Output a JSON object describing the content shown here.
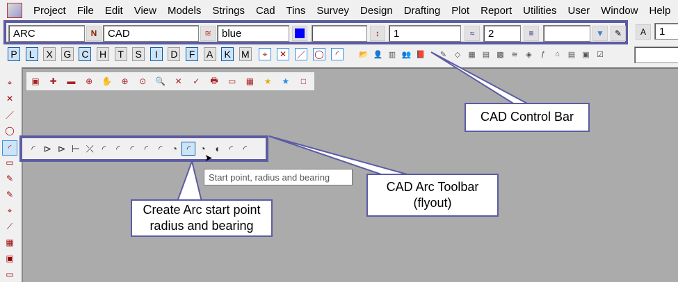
{
  "menu": [
    "Project",
    "File",
    "Edit",
    "View",
    "Models",
    "Strings",
    "Cad",
    "Tins",
    "Survey",
    "Design",
    "Drafting",
    "Plot",
    "Report",
    "Utilities",
    "User",
    "Window",
    "Help"
  ],
  "cad_control_bar": {
    "name_value": "ARC",
    "model_value": "CAD",
    "colour_value": "blue",
    "colour_hex": "#0000ff",
    "height_value": "",
    "chainage_value": "1",
    "weight_value": "2",
    "linestyle_value": "",
    "text_size_value": "1"
  },
  "snap_buttons": [
    {
      "label": "P",
      "on": true
    },
    {
      "label": "L",
      "on": true
    },
    {
      "label": "X",
      "on": false
    },
    {
      "label": "G",
      "on": false
    },
    {
      "label": "C",
      "on": true
    },
    {
      "label": "H",
      "on": false
    },
    {
      "label": "T",
      "on": false
    },
    {
      "label": "S",
      "on": false
    },
    {
      "label": "I",
      "on": true
    },
    {
      "label": "D",
      "on": false
    },
    {
      "label": "F",
      "on": true
    },
    {
      "label": "A",
      "on": false
    },
    {
      "label": "K",
      "on": true
    },
    {
      "label": "M",
      "on": false
    }
  ],
  "tooltip": "Start point, radius and bearing",
  "callouts": {
    "control_bar": "CAD Control Bar",
    "arc_toolbar_line1": "CAD Arc Toolbar",
    "arc_toolbar_line2": "(flyout)",
    "create_arc_line1": "Create Arc start point",
    "create_arc_line2": "radius and bearing"
  },
  "colors": {
    "accent": "#5c5ca3",
    "canvas": "#ababab",
    "selected": "#cce4f7"
  }
}
